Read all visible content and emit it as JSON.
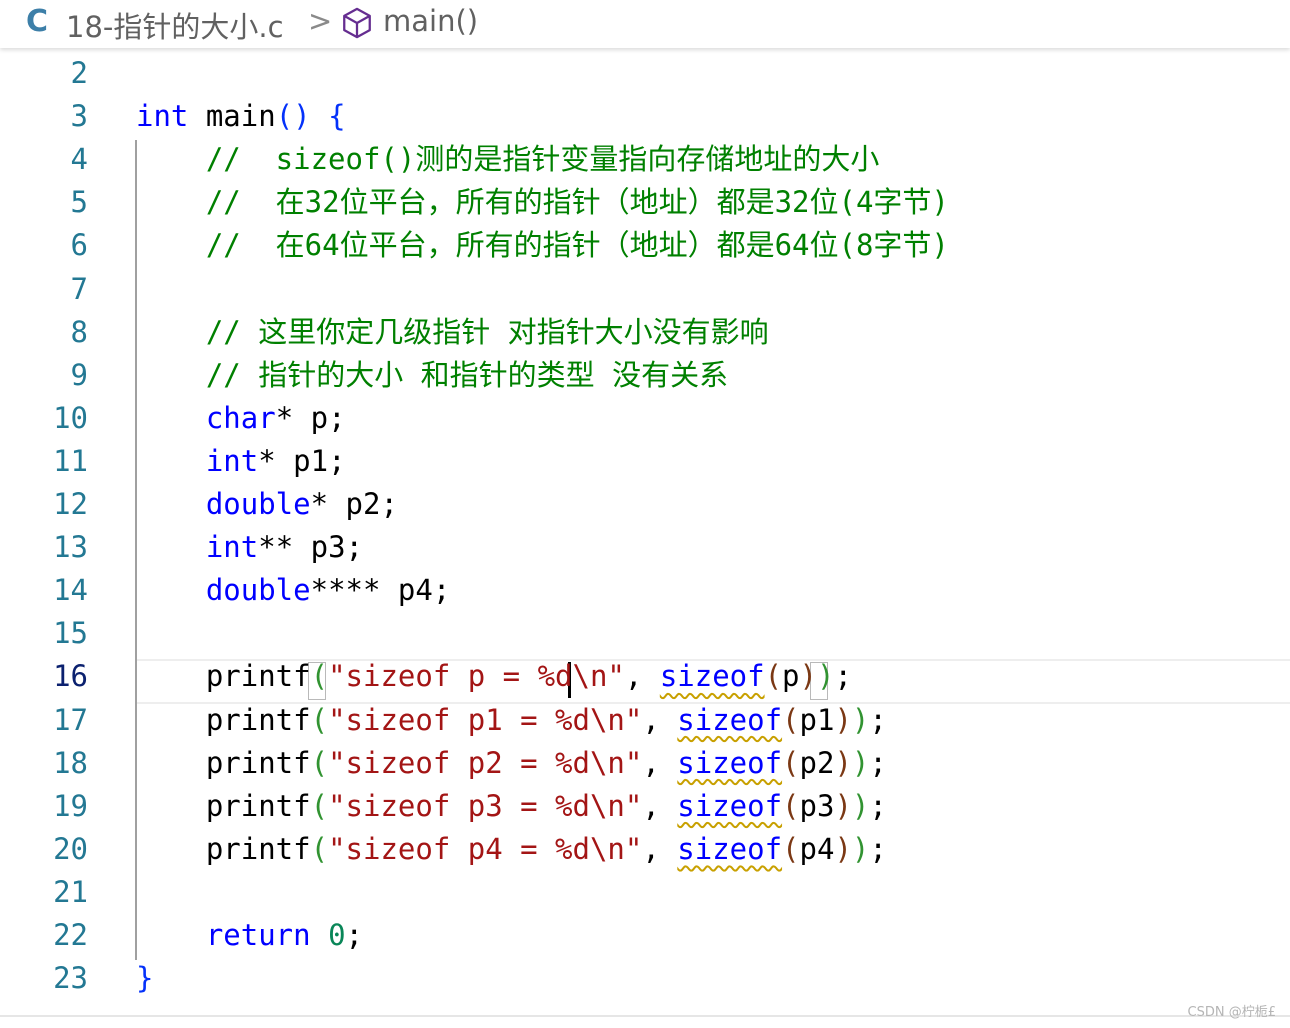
{
  "breadcrumb": {
    "lang_icon": "C",
    "file_name": "18-指针的大小.c",
    "separator": ">",
    "symbol_icon": "cube-icon",
    "function_name": "main()"
  },
  "editor": {
    "active_line": "16",
    "lines": [
      {
        "num": "2",
        "tokens": []
      },
      {
        "num": "3",
        "tokens": [
          {
            "t": "int",
            "c": "kw"
          },
          {
            "t": " main",
            "c": ""
          },
          {
            "t": "()",
            "c": "br1"
          },
          {
            "t": " ",
            "c": ""
          },
          {
            "t": "{",
            "c": "br1"
          }
        ]
      },
      {
        "num": "4",
        "tokens": [
          {
            "t": "    //  sizeof()测的是指针变量指向存储地址的大小",
            "c": "cm"
          }
        ]
      },
      {
        "num": "5",
        "tokens": [
          {
            "t": "    //  在32位平台，所有的指针（地址）都是32位(4字节)",
            "c": "cm"
          }
        ]
      },
      {
        "num": "6",
        "tokens": [
          {
            "t": "    //  在64位平台，所有的指针（地址）都是64位(8字节)",
            "c": "cm"
          }
        ]
      },
      {
        "num": "7",
        "tokens": []
      },
      {
        "num": "8",
        "tokens": [
          {
            "t": "    // 这里你定几级指针 对指针大小没有影响",
            "c": "cm"
          }
        ]
      },
      {
        "num": "9",
        "tokens": [
          {
            "t": "    // 指针的大小 和指针的类型 没有关系",
            "c": "cm"
          }
        ]
      },
      {
        "num": "10",
        "tokens": [
          {
            "t": "    ",
            "c": ""
          },
          {
            "t": "char",
            "c": "kw"
          },
          {
            "t": "* p;",
            "c": ""
          }
        ]
      },
      {
        "num": "11",
        "tokens": [
          {
            "t": "    ",
            "c": ""
          },
          {
            "t": "int",
            "c": "kw"
          },
          {
            "t": "* p1;",
            "c": ""
          }
        ]
      },
      {
        "num": "12",
        "tokens": [
          {
            "t": "    ",
            "c": ""
          },
          {
            "t": "double",
            "c": "kw"
          },
          {
            "t": "* p2;",
            "c": ""
          }
        ]
      },
      {
        "num": "13",
        "tokens": [
          {
            "t": "    ",
            "c": ""
          },
          {
            "t": "int",
            "c": "kw"
          },
          {
            "t": "** p3;",
            "c": ""
          }
        ]
      },
      {
        "num": "14",
        "tokens": [
          {
            "t": "    ",
            "c": ""
          },
          {
            "t": "double",
            "c": "kw"
          },
          {
            "t": "**** p4;",
            "c": ""
          }
        ]
      },
      {
        "num": "15",
        "tokens": []
      },
      {
        "num": "16",
        "tokens": [
          {
            "t": "    printf",
            "c": ""
          },
          {
            "t": "(",
            "c": "br2"
          },
          {
            "t": "\"sizeof p = %d\\n\"",
            "c": "str"
          },
          {
            "t": ", ",
            "c": ""
          },
          {
            "t": "sizeof",
            "c": "kw squig"
          },
          {
            "t": "(",
            "c": "br3"
          },
          {
            "t": "p",
            "c": ""
          },
          {
            "t": ")",
            "c": "br3"
          },
          {
            "t": ")",
            "c": "br2"
          },
          {
            "t": ";",
            "c": ""
          }
        ]
      },
      {
        "num": "17",
        "tokens": [
          {
            "t": "    printf",
            "c": ""
          },
          {
            "t": "(",
            "c": "br2"
          },
          {
            "t": "\"sizeof p1 = %d\\n\"",
            "c": "str"
          },
          {
            "t": ", ",
            "c": ""
          },
          {
            "t": "sizeof",
            "c": "kw squig"
          },
          {
            "t": "(",
            "c": "br3"
          },
          {
            "t": "p1",
            "c": ""
          },
          {
            "t": ")",
            "c": "br3"
          },
          {
            "t": ")",
            "c": "br2"
          },
          {
            "t": ";",
            "c": ""
          }
        ]
      },
      {
        "num": "18",
        "tokens": [
          {
            "t": "    printf",
            "c": ""
          },
          {
            "t": "(",
            "c": "br2"
          },
          {
            "t": "\"sizeof p2 = %d\\n\"",
            "c": "str"
          },
          {
            "t": ", ",
            "c": ""
          },
          {
            "t": "sizeof",
            "c": "kw squig"
          },
          {
            "t": "(",
            "c": "br3"
          },
          {
            "t": "p2",
            "c": ""
          },
          {
            "t": ")",
            "c": "br3"
          },
          {
            "t": ")",
            "c": "br2"
          },
          {
            "t": ";",
            "c": ""
          }
        ]
      },
      {
        "num": "19",
        "tokens": [
          {
            "t": "    printf",
            "c": ""
          },
          {
            "t": "(",
            "c": "br2"
          },
          {
            "t": "\"sizeof p3 = %d\\n\"",
            "c": "str"
          },
          {
            "t": ", ",
            "c": ""
          },
          {
            "t": "sizeof",
            "c": "kw squig"
          },
          {
            "t": "(",
            "c": "br3"
          },
          {
            "t": "p3",
            "c": ""
          },
          {
            "t": ")",
            "c": "br3"
          },
          {
            "t": ")",
            "c": "br2"
          },
          {
            "t": ";",
            "c": ""
          }
        ]
      },
      {
        "num": "20",
        "tokens": [
          {
            "t": "    printf",
            "c": ""
          },
          {
            "t": "(",
            "c": "br2"
          },
          {
            "t": "\"sizeof p4 = %d\\n\"",
            "c": "str"
          },
          {
            "t": ", ",
            "c": ""
          },
          {
            "t": "sizeof",
            "c": "kw squig"
          },
          {
            "t": "(",
            "c": "br3"
          },
          {
            "t": "p4",
            "c": ""
          },
          {
            "t": ")",
            "c": "br3"
          },
          {
            "t": ")",
            "c": "br2"
          },
          {
            "t": ";",
            "c": ""
          }
        ]
      },
      {
        "num": "21",
        "tokens": []
      },
      {
        "num": "22",
        "tokens": [
          {
            "t": "    ",
            "c": ""
          },
          {
            "t": "return",
            "c": "kw"
          },
          {
            "t": " ",
            "c": ""
          },
          {
            "t": "0",
            "c": "num"
          },
          {
            "t": ";",
            "c": ""
          }
        ]
      },
      {
        "num": "23",
        "tokens": [
          {
            "t": "}",
            "c": "br1"
          }
        ]
      }
    ]
  },
  "watermark": "CSDN @柠栀£",
  "colors": {
    "keyword": "#0000ff",
    "comment": "#008000",
    "string": "#a31515",
    "number": "#098658",
    "line_number": "#237893",
    "active_line_number": "#0b216f",
    "warning_squiggle": "#c8a000"
  }
}
